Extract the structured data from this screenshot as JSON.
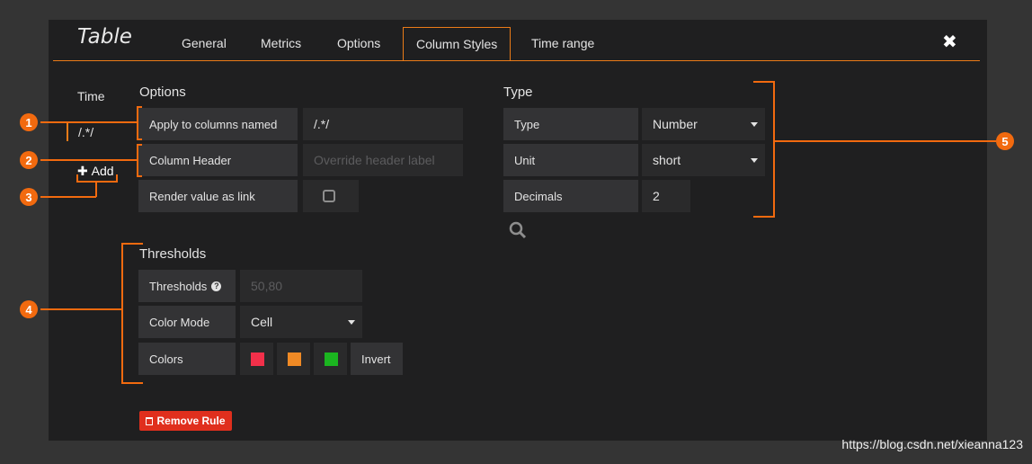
{
  "panel": {
    "title": "Table",
    "close_label": "✖"
  },
  "tabs": [
    {
      "label": "General"
    },
    {
      "label": "Metrics"
    },
    {
      "label": "Options"
    },
    {
      "label": "Column Styles",
      "active": true
    },
    {
      "label": "Time range"
    }
  ],
  "rules": {
    "header": "Time",
    "item": "/.*/",
    "add_label": "Add"
  },
  "options": {
    "title": "Options",
    "apply_label": "Apply to columns named",
    "apply_value": "/.*/",
    "header_label": "Column Header",
    "header_placeholder": "Override header label",
    "link_label": "Render value as link"
  },
  "type": {
    "title": "Type",
    "type_label": "Type",
    "type_value": "Number",
    "unit_label": "Unit",
    "unit_value": "short",
    "decimals_label": "Decimals",
    "decimals_value": "2"
  },
  "thresholds": {
    "title": "Thresholds",
    "thresholds_label": "Thresholds",
    "thresholds_placeholder": "50,80",
    "color_mode_label": "Color Mode",
    "color_mode_value": "Cell",
    "colors_label": "Colors",
    "colors": [
      "#f2304a",
      "#f08a25",
      "#1bb520"
    ],
    "invert_label": "Invert"
  },
  "remove_rule_label": "Remove Rule",
  "callouts": [
    "1",
    "2",
    "3",
    "4",
    "5"
  ],
  "accent_color": "#eb7b18",
  "watermark": "https://blog.csdn.net/xieanna123"
}
